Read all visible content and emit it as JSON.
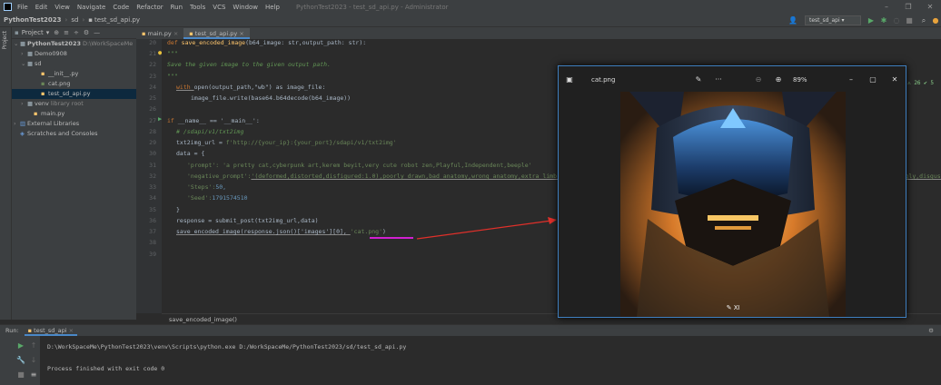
{
  "menubar": {
    "items": [
      "File",
      "Edit",
      "View",
      "Navigate",
      "Code",
      "Refactor",
      "Run",
      "Tools",
      "VCS",
      "Window",
      "Help"
    ],
    "window_title": "PythonTest2023 - test_sd_api.py - Administrator"
  },
  "navbar": {
    "project": "PythonTest2023",
    "folder": "sd",
    "file": "test_sd_api.py",
    "run_config": "test_sd_api"
  },
  "sidebar": {
    "strip_label": "Project",
    "header": "Project",
    "tree": [
      {
        "label": "PythonTest2023",
        "extra": "D:\\WorkSpaceMe"
      },
      {
        "label": "Demo0908"
      },
      {
        "label": "sd"
      },
      {
        "label": "__init__.py"
      },
      {
        "label": "cat.png"
      },
      {
        "label": "test_sd_api.py"
      },
      {
        "label": "venv",
        "extra": "library root"
      },
      {
        "label": "main.py"
      },
      {
        "label": "External Libraries"
      },
      {
        "label": "Scratches and Consoles"
      }
    ]
  },
  "editor": {
    "tabs": [
      "main.py",
      "test_sd_api.py"
    ],
    "line_numbers": [
      "20",
      "21",
      "22",
      "23",
      "24",
      "25",
      "26",
      "27",
      "28",
      "29",
      "30",
      "31",
      "32",
      "33",
      "34",
      "35",
      "36",
      "37",
      "38",
      "39"
    ],
    "inspection": "⚠ 26  ✔ 5",
    "breadcrumb": "save_encoded_image()",
    "code": {
      "l20_def": "def ",
      "l20_name": "save_encoded_image",
      "l20_args": "(b64_image: str,output_path: str):",
      "l21": "\"\"\"",
      "l22": "Save the given image to the given output path.",
      "l23": "\"\"\"",
      "l24_kw": "with ",
      "l24_rest": "open(output_path,\"wb\") as image_file:",
      "l25": "image_file.write(base64.b64decode(b64_image))",
      "l27_kw": "if ",
      "l27_rest": "__name__ == '__main__':",
      "l28": "# /sdapi/v1/txt2img",
      "l29_a": "txt2img_url = ",
      "l29_b": "f'http://{your_ip}:{your_port}/sdapi/v1/txt2img'",
      "l30": "data = {",
      "l31_k": "'prompt': ",
      "l31_v": "'a pretty cat,cyberpunk art,kerem beyit,very cute robot zen,Playful,Independent,beeple'",
      "l32_k": "'negative_prompt':",
      "l32_v": "'(deformed,distorted,disfigured:1.0),poorly drawn,bad anatomy,wrong anatomy,extra limb,missing limb,floating limbs,(mutated hands and fingers:1.4),disconnected limbs,mutation,mutated,ugly,disgusting,blurry,amputation'",
      "l33_k": "'Steps':",
      "l33_v": "50,",
      "l34_k": "'Seed':",
      "l34_v": "1791574510",
      "l35": "}",
      "l36": "response = submit_post(txt2img_url,data)",
      "l37_a": "save_encoded_image(response.json()['images'][0], ",
      "l37_b": "'cat.png'",
      "l37_c": ")"
    }
  },
  "run": {
    "label": "Run:",
    "tab": "test_sd_api",
    "command": "D:\\WorkSpaceMe\\PythonTest2023\\venv\\Scripts\\python.exe D:/WorkSpaceMe/PythonTest2023/sd/test_sd_api.py",
    "result": "Process finished with exit code 0"
  },
  "viewer": {
    "filename": "cat.png",
    "zoom": "89%"
  },
  "colors": {
    "accent": "#3f7fbf",
    "annotation_arrow": "#e0302a",
    "annotation_underline": "#d020d0"
  }
}
